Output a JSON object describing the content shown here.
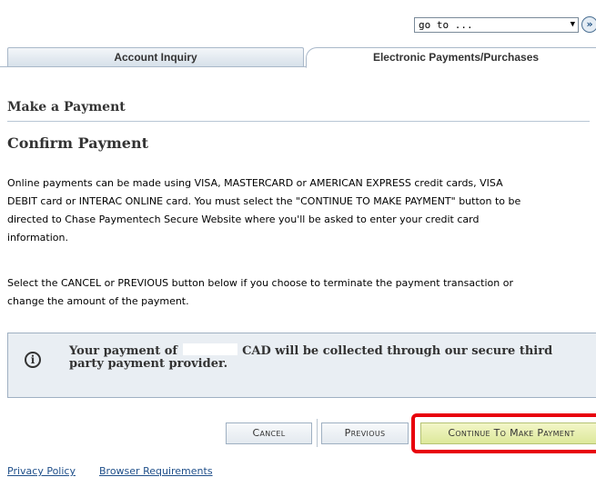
{
  "topbar": {
    "goto_select_value": "go to ...",
    "goto_arrow": "▼",
    "go_icon_glyph": "»"
  },
  "tabs": [
    {
      "label": "Account Inquiry",
      "active": false
    },
    {
      "label": "Electronic Payments/Purchases",
      "active": true
    }
  ],
  "page": {
    "title": "Make a Payment",
    "subtitle": "Confirm Payment",
    "paragraph1_line1": "Online payments can be made using VISA, MASTERCARD or AMERICAN EXPRESS credit cards, VISA",
    "paragraph1_line2": "DEBIT card or INTERAC ONLINE card. You must select the \"CONTINUE TO MAKE PAYMENT\" button to be",
    "paragraph1_line3": "directed to Chase Paymentech Secure Website where you'll be asked to enter your credit card",
    "paragraph1_line4": "information.",
    "paragraph2_line1": "Select the CANCEL or PREVIOUS button below if you choose to terminate the payment transaction or",
    "paragraph2_line2": "change the amount of the payment."
  },
  "info": {
    "icon": "info-icon",
    "icon_glyph": "i",
    "text_before": "Your payment of",
    "amount": "",
    "text_after": "CAD will be collected through our secure third",
    "text_line2": "party payment provider."
  },
  "buttons": {
    "cancel": "Cancel",
    "previous": "Previous",
    "continue": "Continue To Make Payment"
  },
  "footer": {
    "privacy": "Privacy Policy",
    "browser": "Browser Requirements"
  },
  "colors": {
    "highlight": "#e8000b",
    "link": "#1f4f8a",
    "continue_bg": "#dde89a"
  }
}
